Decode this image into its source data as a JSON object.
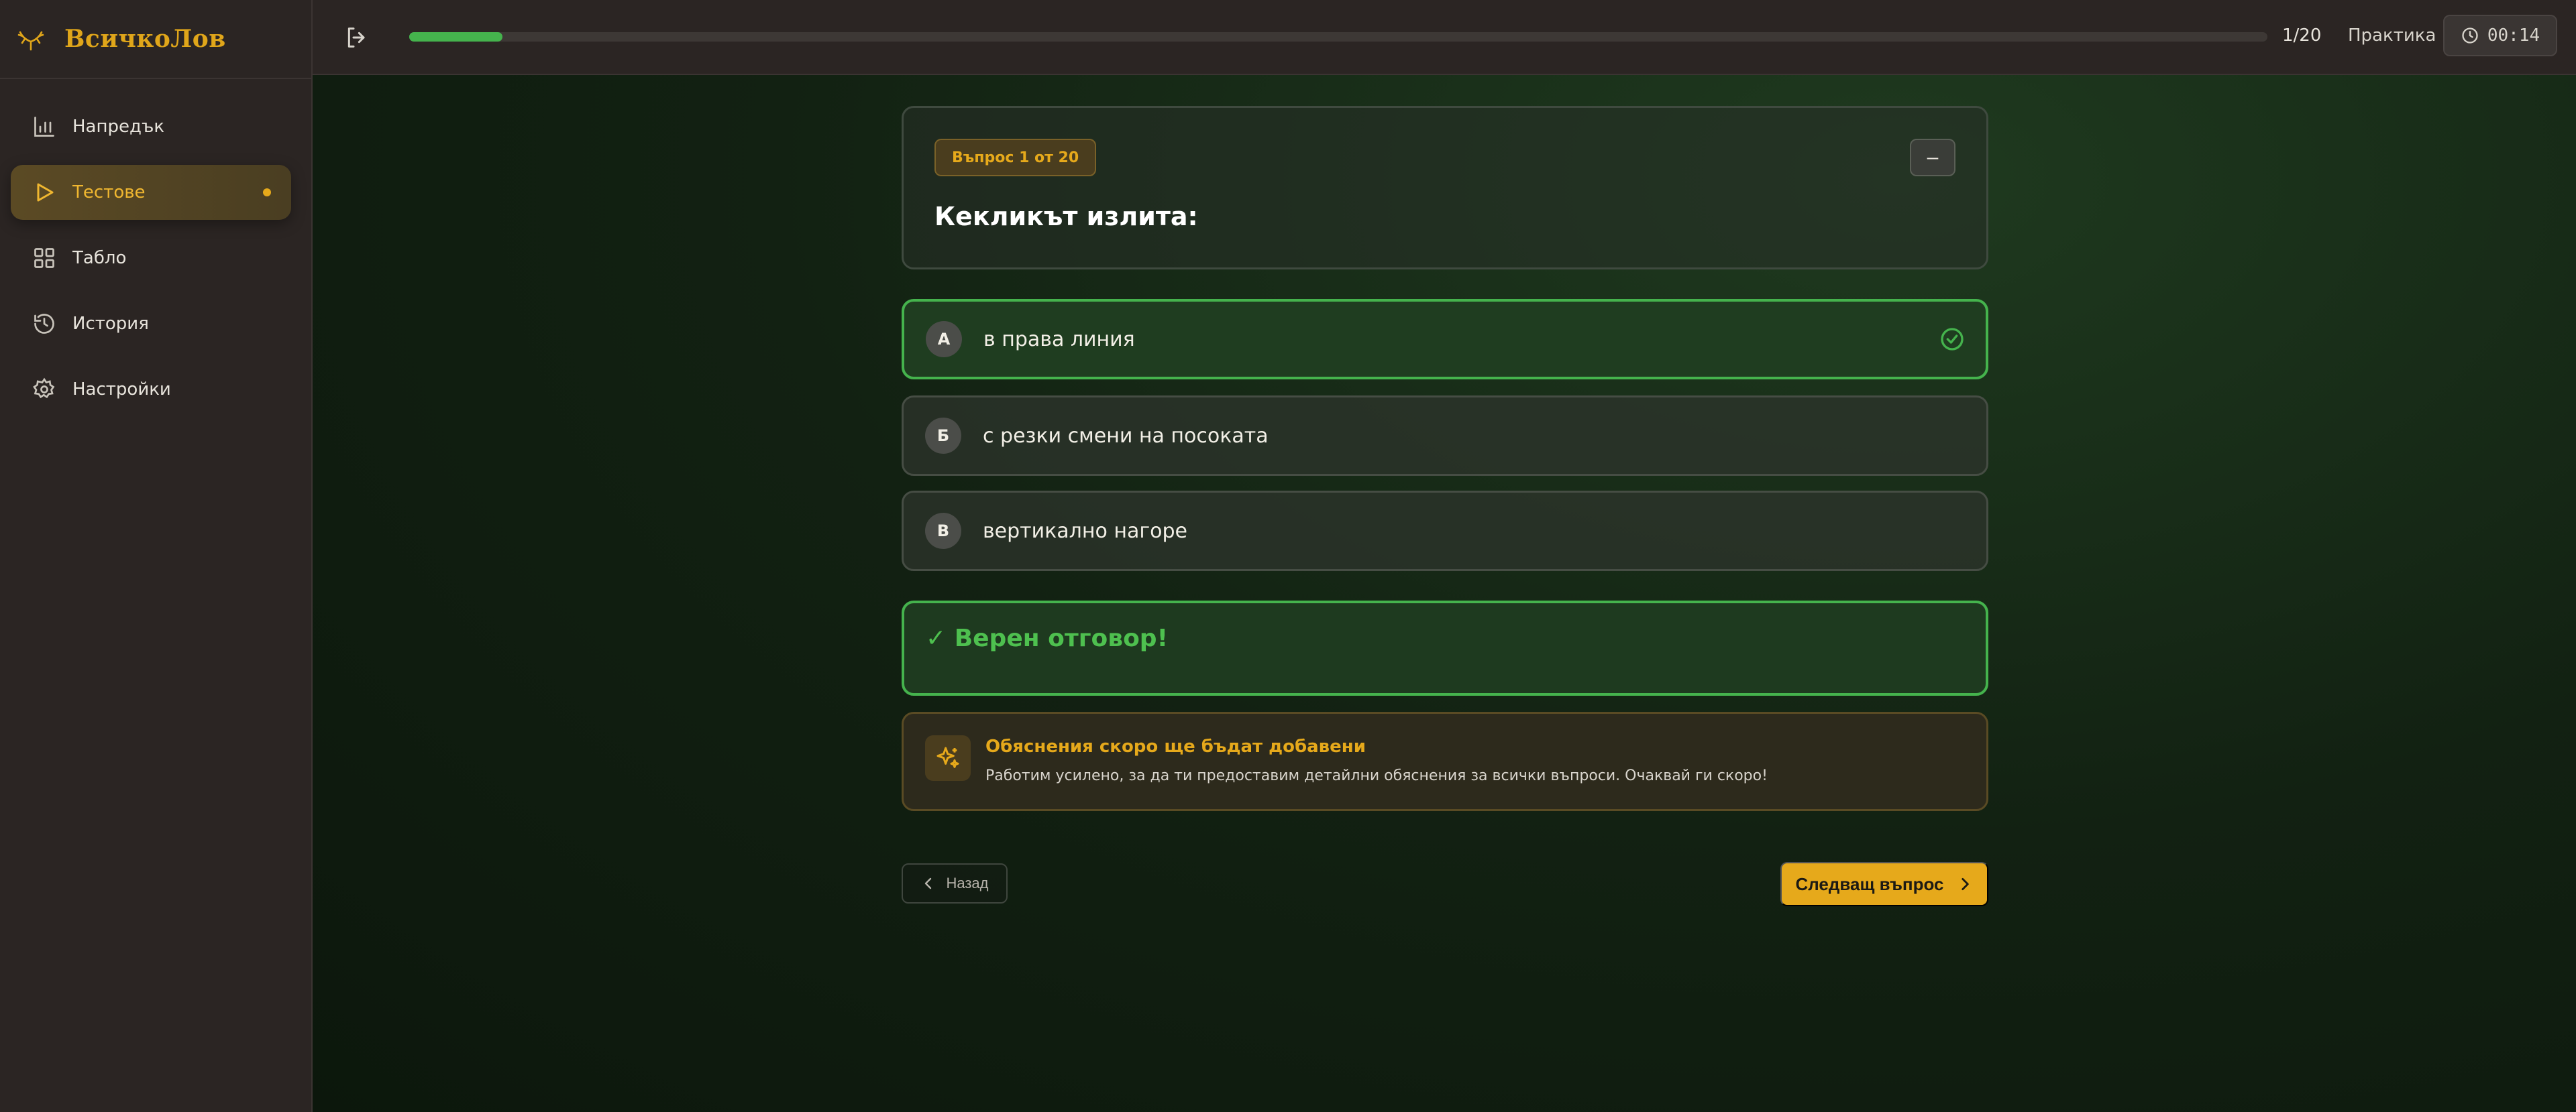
{
  "brand": {
    "name": "ВсичкоЛов"
  },
  "sidebar": {
    "items": [
      {
        "label": "Напредък",
        "icon": "chart-bar-icon",
        "active": false
      },
      {
        "label": "Тестове",
        "icon": "play-icon",
        "active": true
      },
      {
        "label": "Табло",
        "icon": "grid-icon",
        "active": false
      },
      {
        "label": "История",
        "icon": "history-icon",
        "active": false
      },
      {
        "label": "Настройки",
        "icon": "gear-icon",
        "active": false
      }
    ]
  },
  "topbar": {
    "progress_fraction": 0.05,
    "counter": "1/20",
    "mode": "Практика",
    "timer": "00:14"
  },
  "question": {
    "badge": "Въпрос 1 от 20",
    "collapse_label": "–",
    "text": "Кекликът излита:"
  },
  "options": [
    {
      "letter": "А",
      "text": "в права линия",
      "correct": true
    },
    {
      "letter": "Б",
      "text": "с резки смени на посоката",
      "correct": false
    },
    {
      "letter": "В",
      "text": "вертикално нагоре",
      "correct": false
    }
  ],
  "result": {
    "text": "✓ Верен отговор!"
  },
  "info": {
    "title": "Обяснения скоро ще бъдат добавени",
    "text": "Работим усилено, за да ти предоставим детайлни обяснения за всички въпроси. Очаквай ги скоро!"
  },
  "nav_buttons": {
    "back": "Назад",
    "next": "Следващ въпрос"
  },
  "colors": {
    "accent": "#e6a91b",
    "correct": "#45b34d",
    "sidebar": "#2b2523"
  }
}
